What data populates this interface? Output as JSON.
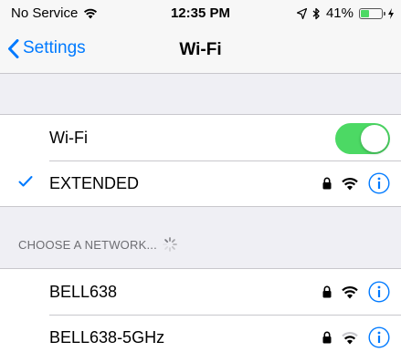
{
  "status_bar": {
    "carrier": "No Service",
    "time": "12:35 PM",
    "battery_percent": "41%",
    "battery_level": 0.41,
    "icons": [
      "wifi-signal-icon",
      "location-arrow-icon",
      "bluetooth-icon",
      "battery-icon",
      "charging-bolt-icon"
    ]
  },
  "nav": {
    "back_label": "Settings",
    "title": "Wi-Fi"
  },
  "wifi_toggle": {
    "label": "Wi-Fi",
    "on": true
  },
  "connected_network": {
    "name": "EXTENDED",
    "locked": true,
    "signal_bars": 3
  },
  "networks_section": {
    "header": "CHOOSE A NETWORK...",
    "networks": [
      {
        "name": "BELL638",
        "locked": true,
        "signal_bars": 3
      },
      {
        "name": "BELL638-5GHz",
        "locked": true,
        "signal_bars": 2
      }
    ]
  },
  "colors": {
    "accent": "#007aff",
    "toggle_on": "#4cd964",
    "group_background": "#efeff4",
    "separator": "#c8c7cc",
    "section_header_text": "#6d6d72"
  }
}
